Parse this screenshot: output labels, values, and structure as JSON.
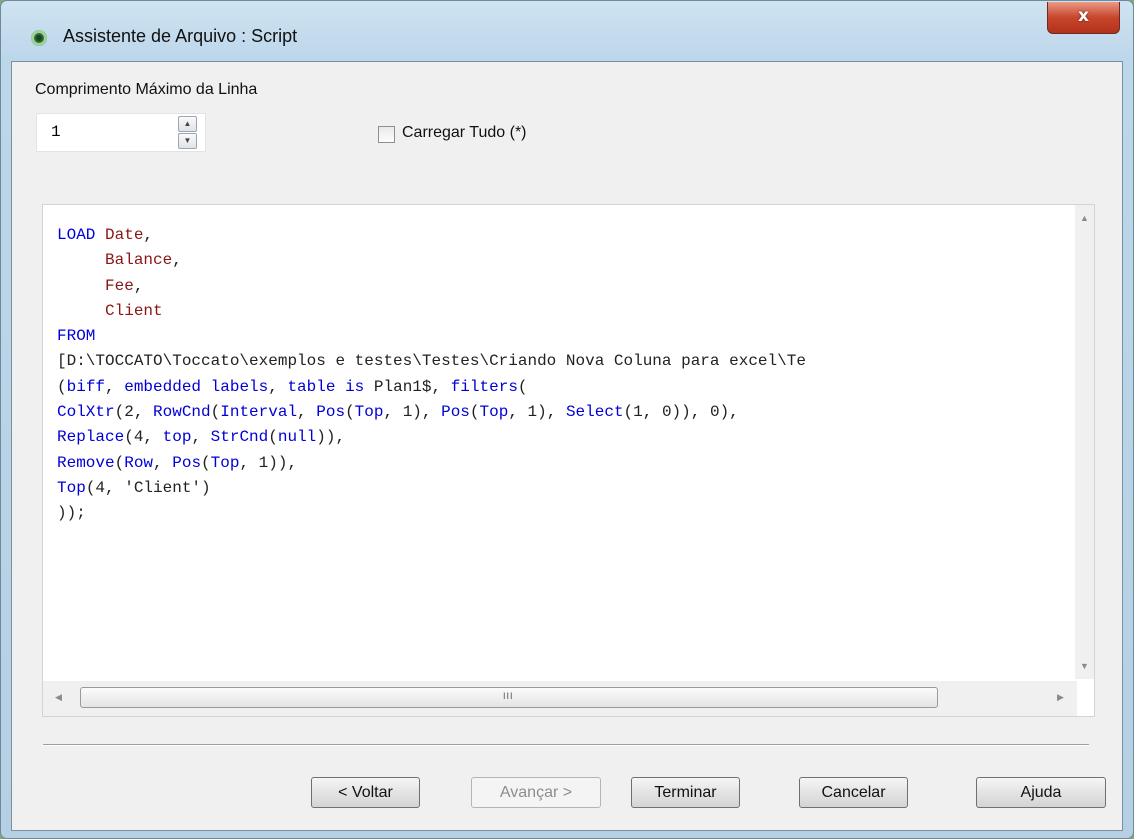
{
  "window": {
    "title": "Assistente de Arquivo : Script",
    "close_label": "x"
  },
  "max_line": {
    "label": "Comprimento Máximo da Linha",
    "value": "1"
  },
  "load_all": {
    "label": "Carregar Tudo (*)",
    "checked": false
  },
  "script_lines": [
    "LOAD Date,",
    "     Balance,",
    "     Fee,",
    "     Client",
    "FROM",
    "[D:\\TOCCATO\\Toccato\\exemplos e testes\\Testes\\Criando Nova Coluna para excel\\Te",
    "(biff, embedded labels, table is Plan1$, filters(",
    "ColXtr(2, RowCnd(Interval, Pos(Top, 1), Pos(Top, 1), Select(1, 0)), 0),",
    "Replace(4, top, StrCnd(null)),",
    "Remove(Row, Pos(Top, 1)),",
    "Top(4, 'Client')",
    "));"
  ],
  "buttons": {
    "back": "< Voltar",
    "next": "Avançar >",
    "finish": "Terminar",
    "cancel": "Cancelar",
    "help": "Ajuda"
  },
  "scroll_grip": "III",
  "colors": {
    "keyword": "#0000d8",
    "field": "#8b1515",
    "close": "#c8452d"
  }
}
